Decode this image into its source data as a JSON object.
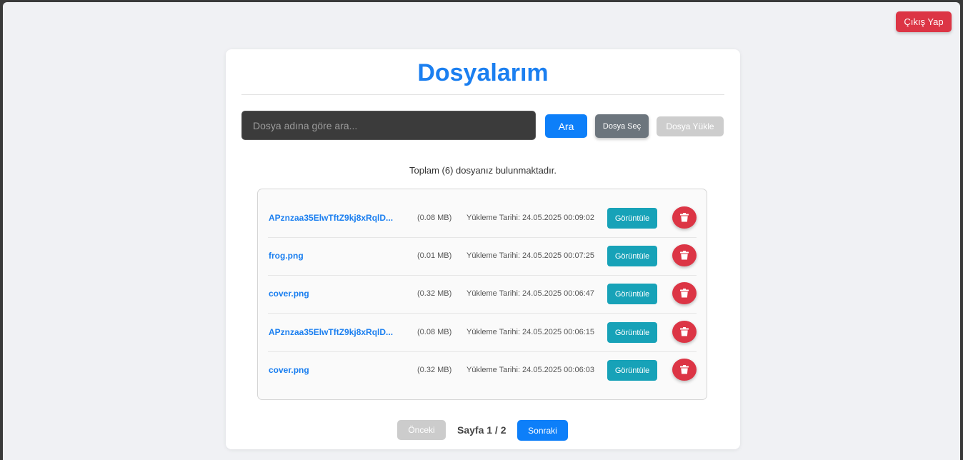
{
  "header": {
    "logout_label": "Çıkış Yap"
  },
  "main": {
    "title": "Dosyalarım",
    "search": {
      "placeholder": "Dosya adına göre ara...",
      "value": ""
    },
    "search_button": "Ara",
    "choose_file_button": "Dosya Seç",
    "upload_button": "Dosya Yükle",
    "total_text": "Toplam (6) dosyanız bulunmaktadır."
  },
  "files": [
    {
      "name": "APznzaa35ElwTftZ9kj8xRqlD...",
      "size": "(0.08 MB)",
      "date": "Yükleme Tarihi: 24.05.2025 00:09:02",
      "view_label": "Görüntüle"
    },
    {
      "name": "frog.png",
      "size": "(0.01 MB)",
      "date": "Yükleme Tarihi: 24.05.2025 00:07:25",
      "view_label": "Görüntüle"
    },
    {
      "name": "cover.png",
      "size": "(0.32 MB)",
      "date": "Yükleme Tarihi: 24.05.2025 00:06:47",
      "view_label": "Görüntüle"
    },
    {
      "name": "APznzaa35ElwTftZ9kj8xRqlD...",
      "size": "(0.08 MB)",
      "date": "Yükleme Tarihi: 24.05.2025 00:06:15",
      "view_label": "Görüntüle"
    },
    {
      "name": "cover.png",
      "size": "(0.32 MB)",
      "date": "Yükleme Tarihi: 24.05.2025 00:06:03",
      "view_label": "Görüntüle"
    }
  ],
  "icons": {
    "delete": "trash-icon"
  },
  "pagination": {
    "prev_label": "Önceki",
    "page_text": "Sayfa 1 / 2",
    "next_label": "Sonraki"
  },
  "colors": {
    "primary": "#0d7ff9",
    "danger": "#dc3545",
    "info": "#17a2b8",
    "secondary": "#6c757d",
    "title": "#1b7ff0"
  }
}
